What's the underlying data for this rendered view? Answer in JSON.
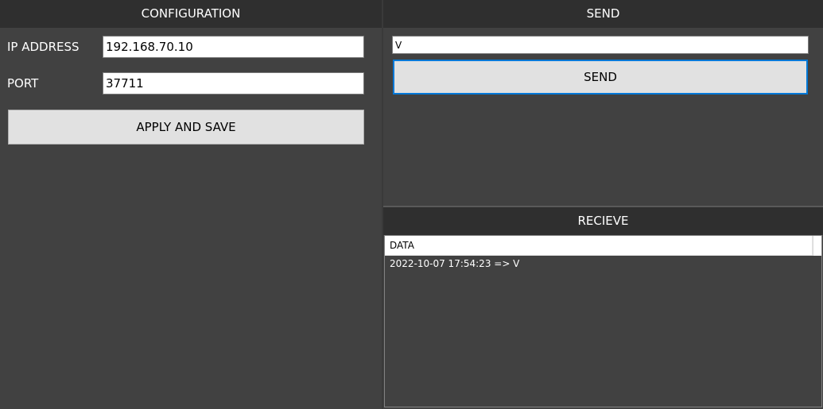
{
  "config": {
    "title": "CONFIGURATION",
    "ip_label": "IP ADDRESS",
    "ip_value": "192.168.70.10",
    "port_label": "PORT",
    "port_value": "37711",
    "apply_label": "APPLY AND SAVE"
  },
  "send": {
    "title": "SEND",
    "input_value": "V",
    "button_label": "SEND"
  },
  "receive": {
    "title": "RECIEVE",
    "column_header": "DATA",
    "items": [
      "2022-10-07 17:54:23 => V"
    ]
  },
  "colors": {
    "panel_bg": "#414141",
    "header_bg": "#2f2f2f",
    "button_bg": "#e1e1e1",
    "focus_accent": "#0078d7"
  }
}
